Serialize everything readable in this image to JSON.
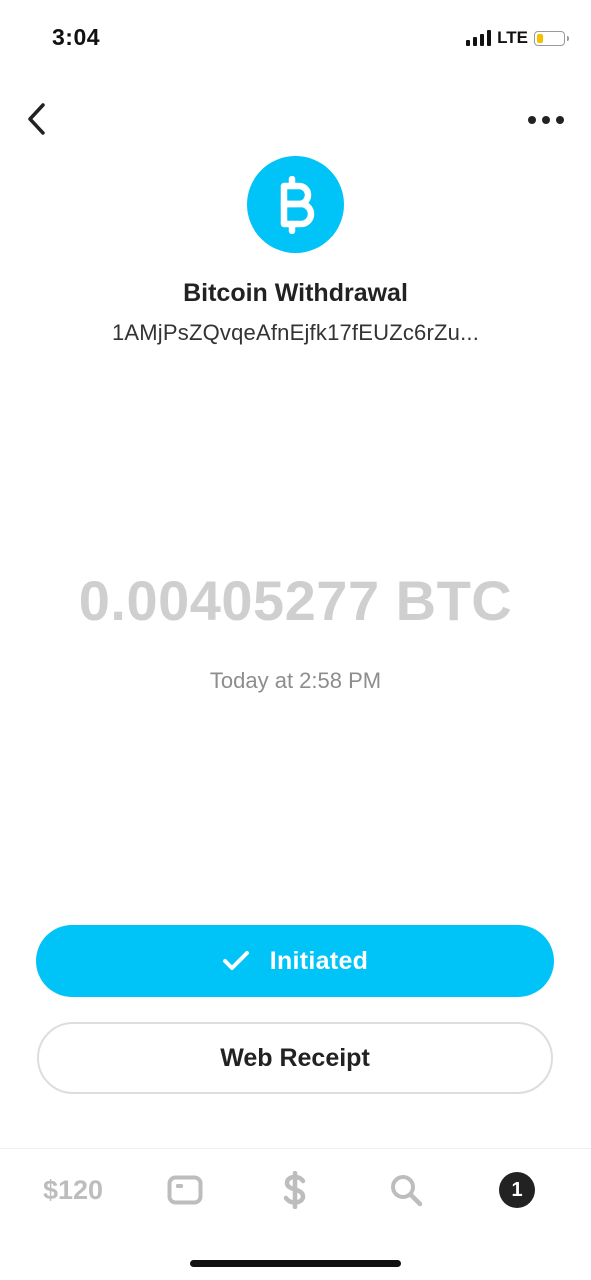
{
  "status_bar": {
    "time": "3:04",
    "network": "LTE",
    "battery_level": 0.25,
    "battery_color": "#f2c100"
  },
  "nav": {
    "back_icon": "chevron-left-icon",
    "more_icon": "ellipsis-icon"
  },
  "header": {
    "icon": "bitcoin-icon",
    "icon_color": "#00c3f7",
    "title": "Bitcoin Withdrawal",
    "address": "1AMjPsZQvqeAfnEjfk17fEUZc6rZu..."
  },
  "transaction": {
    "amount": "0.00405277 BTC",
    "timestamp": "Today at 2:58 PM"
  },
  "actions": {
    "status_label": "Initiated",
    "status_icon": "checkmark-icon",
    "status_color": "#00c3f7",
    "receipt_label": "Web Receipt"
  },
  "tab_bar": {
    "balance": "$120",
    "activity_badge": "1",
    "icons": [
      "card-icon",
      "dollar-icon",
      "search-icon",
      "activity-icon"
    ]
  }
}
